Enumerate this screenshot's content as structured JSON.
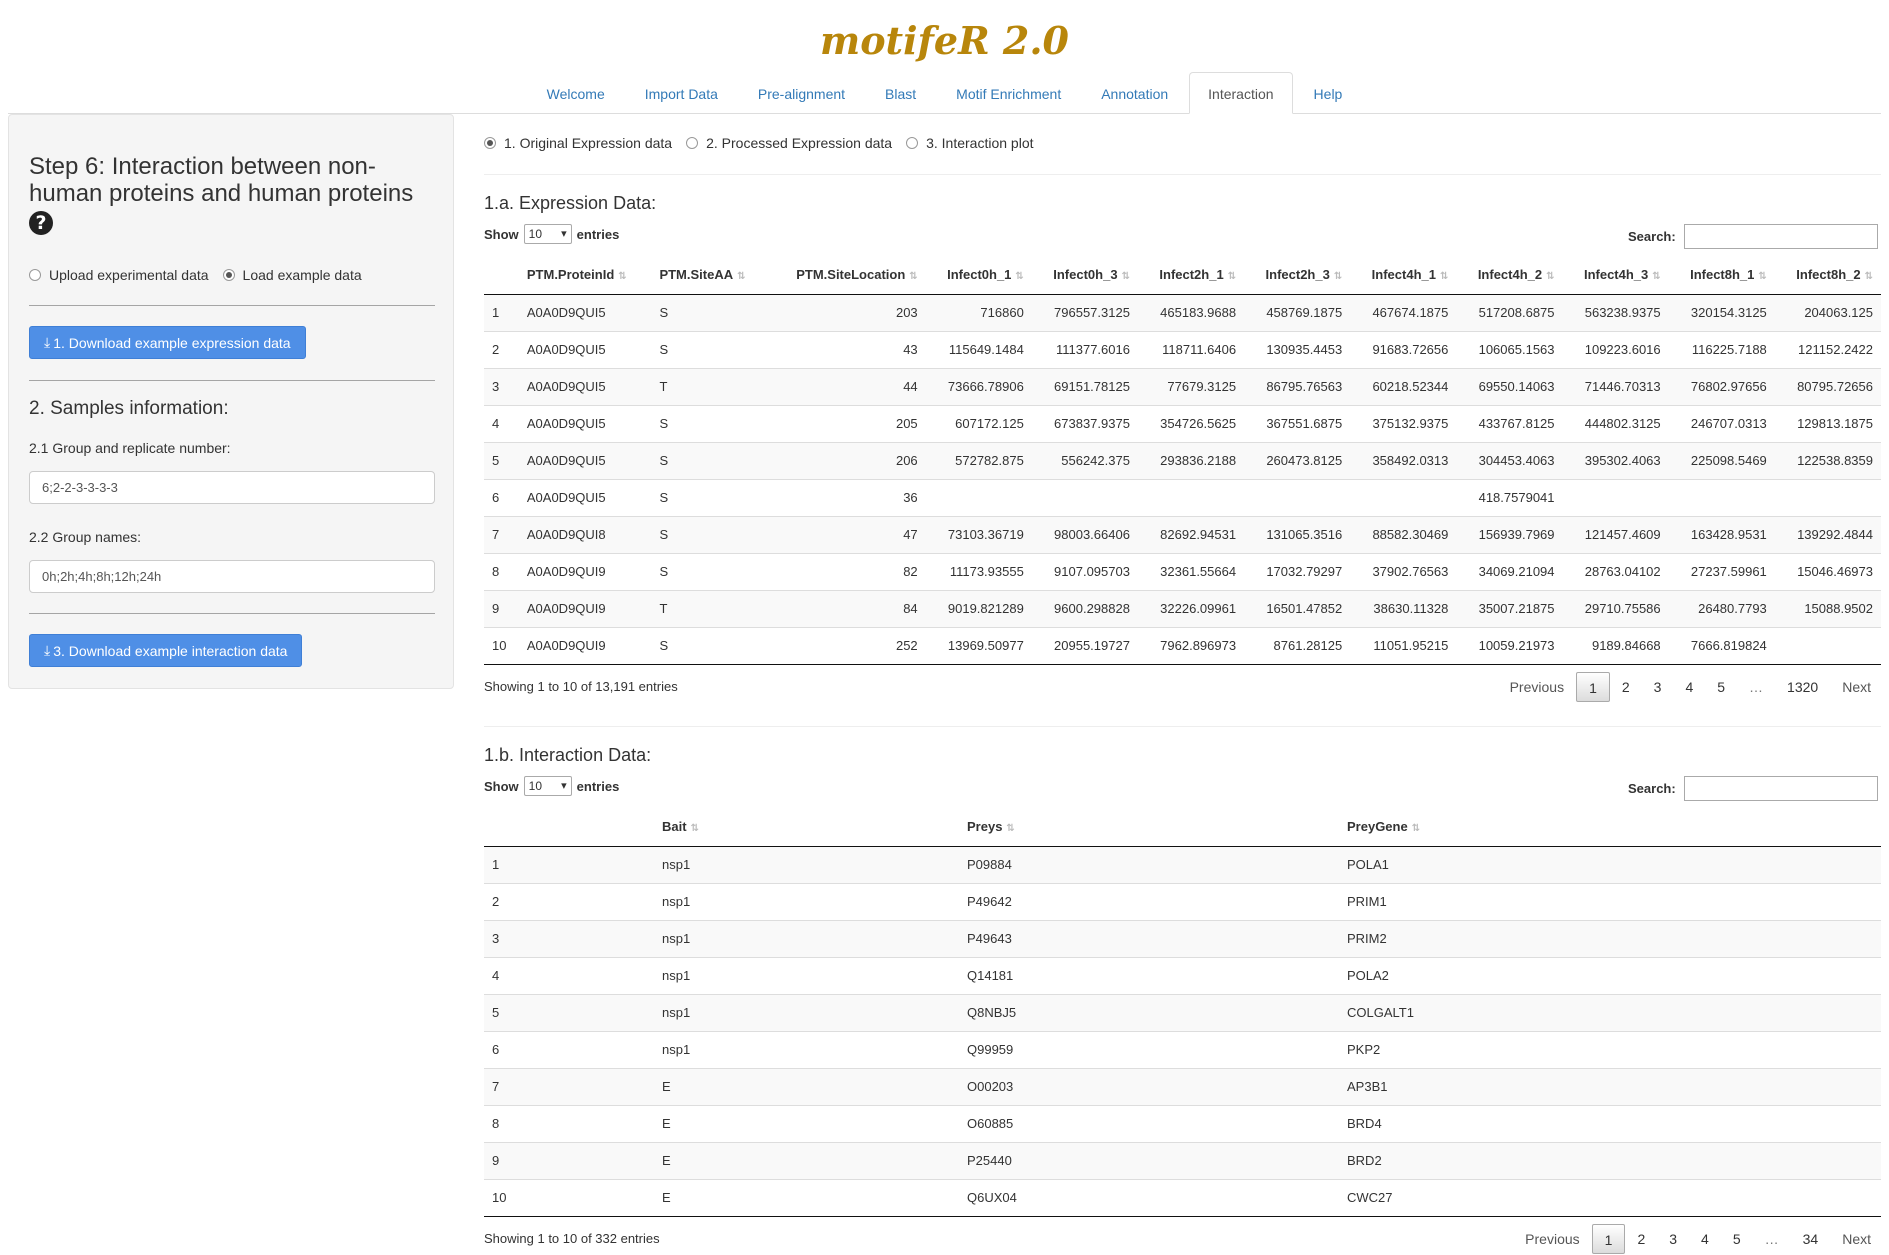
{
  "app": {
    "title": "motifeR 2.0"
  },
  "nav": {
    "tabs": [
      "Welcome",
      "Import Data",
      "Pre-alignment",
      "Blast",
      "Motif Enrichment",
      "Annotation",
      "Interaction",
      "Help"
    ],
    "active": "Interaction"
  },
  "sidebar": {
    "title": "Step 6: Interaction between non-human proteins and human proteins",
    "help_icon": "question-circle-icon",
    "data_source": {
      "options": [
        "Upload experimental data",
        "Load example data"
      ],
      "selected": "Load example data"
    },
    "download_expression_label": "1. Download example expression data",
    "samples_heading": "2. Samples information:",
    "group_replicate_label": "2.1 Group and replicate number:",
    "group_replicate_value": "6;2-2-3-3-3-3",
    "group_names_label": "2.2 Group names:",
    "group_names_value": "0h;2h;4h;8h;12h;24h",
    "download_interaction_label": "3. Download example interaction data"
  },
  "main": {
    "view_options": [
      "1. Original Expression data",
      "2. Processed Expression data",
      "3. Interaction plot"
    ],
    "view_selected": "1. Original Expression data",
    "expression": {
      "title": "1.a. Expression Data:",
      "show_label": "Show",
      "page_size": "10",
      "entries_label": "entries",
      "search_label": "Search:",
      "columns": [
        "",
        "PTM.ProteinId",
        "PTM.SiteAA",
        "PTM.SiteLocation",
        "Infect0h_1",
        "Infect0h_3",
        "Infect2h_1",
        "Infect2h_3",
        "Infect4h_1",
        "Infect4h_2",
        "Infect4h_3",
        "Infect8h_1",
        "Infect8h_2"
      ],
      "rows": [
        [
          "1",
          "A0A0D9QUI5",
          "S",
          "203",
          "716860",
          "796557.3125",
          "465183.9688",
          "458769.1875",
          "467674.1875",
          "517208.6875",
          "563238.9375",
          "320154.3125",
          "204063.125"
        ],
        [
          "2",
          "A0A0D9QUI5",
          "S",
          "43",
          "115649.1484",
          "111377.6016",
          "118711.6406",
          "130935.4453",
          "91683.72656",
          "106065.1563",
          "109223.6016",
          "116225.7188",
          "121152.2422"
        ],
        [
          "3",
          "A0A0D9QUI5",
          "T",
          "44",
          "73666.78906",
          "69151.78125",
          "77679.3125",
          "86795.76563",
          "60218.52344",
          "69550.14063",
          "71446.70313",
          "76802.97656",
          "80795.72656"
        ],
        [
          "4",
          "A0A0D9QUI5",
          "S",
          "205",
          "607172.125",
          "673837.9375",
          "354726.5625",
          "367551.6875",
          "375132.9375",
          "433767.8125",
          "444802.3125",
          "246707.0313",
          "129813.1875"
        ],
        [
          "5",
          "A0A0D9QUI5",
          "S",
          "206",
          "572782.875",
          "556242.375",
          "293836.2188",
          "260473.8125",
          "358492.0313",
          "304453.4063",
          "395302.4063",
          "225098.5469",
          "122538.8359"
        ],
        [
          "6",
          "A0A0D9QUI5",
          "S",
          "36",
          "",
          "",
          "",
          "",
          "",
          "418.7579041",
          "",
          "",
          ""
        ],
        [
          "7",
          "A0A0D9QUI8",
          "S",
          "47",
          "73103.36719",
          "98003.66406",
          "82692.94531",
          "131065.3516",
          "88582.30469",
          "156939.7969",
          "121457.4609",
          "163428.9531",
          "139292.4844"
        ],
        [
          "8",
          "A0A0D9QUI9",
          "S",
          "82",
          "11173.93555",
          "9107.095703",
          "32361.55664",
          "17032.79297",
          "37902.76563",
          "34069.21094",
          "28763.04102",
          "27237.59961",
          "15046.46973"
        ],
        [
          "9",
          "A0A0D9QUI9",
          "T",
          "84",
          "9019.821289",
          "9600.298828",
          "32226.09961",
          "16501.47852",
          "38630.11328",
          "35007.21875",
          "29710.75586",
          "26480.7793",
          "15088.9502"
        ],
        [
          "10",
          "A0A0D9QUI9",
          "S",
          "252",
          "13969.50977",
          "20955.19727",
          "7962.896973",
          "8761.28125",
          "11051.95215",
          "10059.21973",
          "9189.84668",
          "7666.819824",
          ""
        ]
      ],
      "info": "Showing 1 to 10 of 13,191 entries",
      "pagination": [
        "Previous",
        "1",
        "2",
        "3",
        "4",
        "5",
        "…",
        "1320",
        "Next"
      ],
      "current_page": "1"
    },
    "interaction": {
      "title": "1.b. Interaction Data:",
      "show_label": "Show",
      "page_size": "10",
      "entries_label": "entries",
      "search_label": "Search:",
      "columns": [
        "",
        "Bait",
        "Preys",
        "PreyGene"
      ],
      "rows": [
        [
          "1",
          "nsp1",
          "P09884",
          "POLA1"
        ],
        [
          "2",
          "nsp1",
          "P49642",
          "PRIM1"
        ],
        [
          "3",
          "nsp1",
          "P49643",
          "PRIM2"
        ],
        [
          "4",
          "nsp1",
          "Q14181",
          "POLA2"
        ],
        [
          "5",
          "nsp1",
          "Q8NBJ5",
          "COLGALT1"
        ],
        [
          "6",
          "nsp1",
          "Q99959",
          "PKP2"
        ],
        [
          "7",
          "E",
          "O00203",
          "AP3B1"
        ],
        [
          "8",
          "E",
          "O60885",
          "BRD4"
        ],
        [
          "9",
          "E",
          "P25440",
          "BRD2"
        ],
        [
          "10",
          "E",
          "Q6UX04",
          "CWC27"
        ]
      ],
      "info": "Showing 1 to 10 of 332 entries",
      "pagination": [
        "Previous",
        "1",
        "2",
        "3",
        "4",
        "5",
        "…",
        "34",
        "Next"
      ],
      "current_page": "1"
    }
  }
}
